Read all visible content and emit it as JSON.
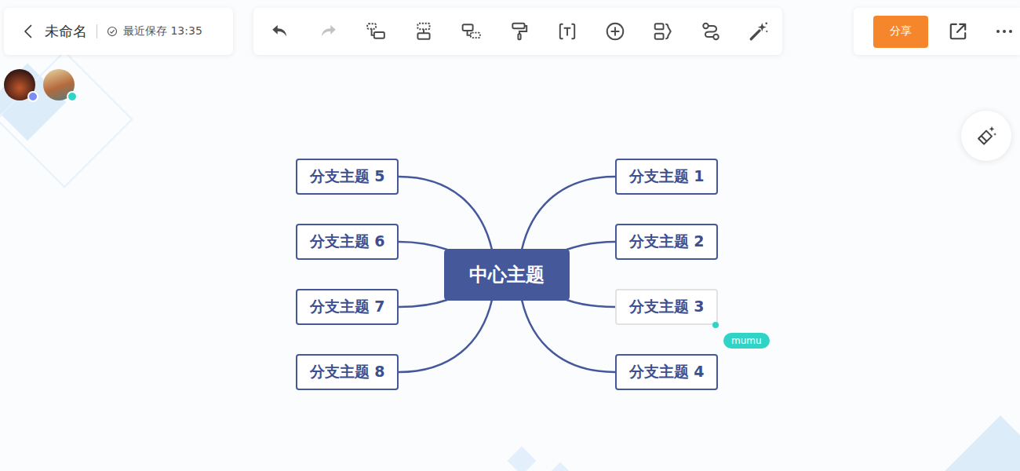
{
  "document": {
    "title": "未命名",
    "save_status": "最近保存 13:35"
  },
  "toolbar": [
    {
      "disabled": false
    },
    {
      "disabled": true
    },
    {
      "disabled": false
    },
    {
      "disabled": false
    },
    {
      "disabled": false
    },
    {
      "disabled": false
    },
    {
      "disabled": false
    },
    {
      "disabled": false
    },
    {
      "disabled": false
    },
    {
      "disabled": false
    },
    {
      "disabled": false
    }
  ],
  "share_button": "分享",
  "collaborators": [
    {
      "color": "#7b8df2"
    },
    {
      "color": "#2fd4c7"
    }
  ],
  "mindmap": {
    "center": "中心主题",
    "right_branches": [
      {
        "label": "分支主题 1",
        "hovered": false
      },
      {
        "label": "分支主题 2",
        "hovered": false
      },
      {
        "label": "分支主题 3",
        "hovered": true
      },
      {
        "label": "分支主题 4",
        "hovered": false
      }
    ],
    "left_branches": [
      {
        "label": "分支主题 5",
        "hovered": false
      },
      {
        "label": "分支主题 6",
        "hovered": false
      },
      {
        "label": "分支主题 7",
        "hovered": false
      },
      {
        "label": "分支主题 8",
        "hovered": false
      }
    ]
  },
  "remote_cursor": {
    "user": "mumu",
    "color": "#2fd4c7"
  }
}
